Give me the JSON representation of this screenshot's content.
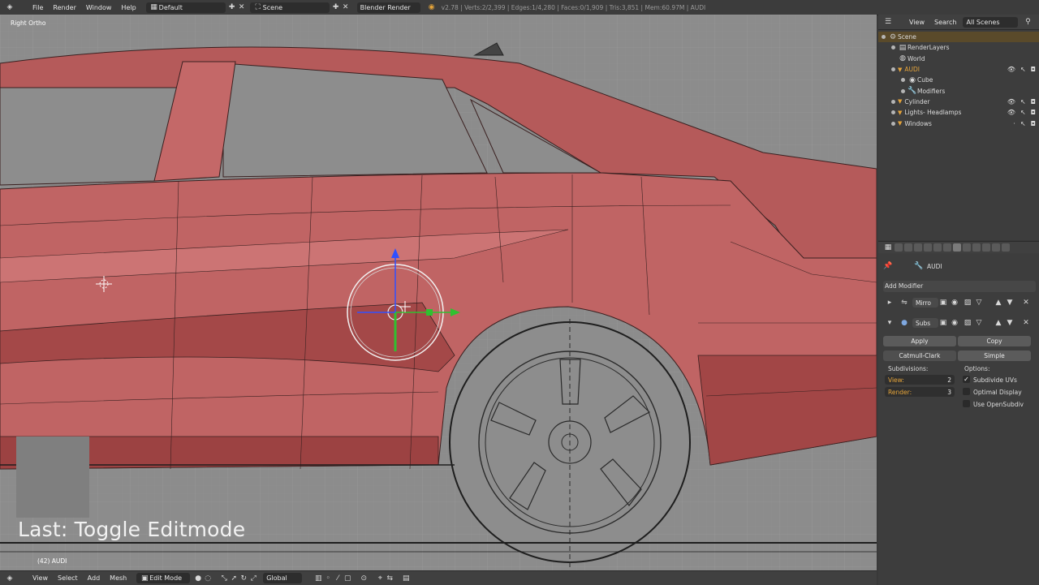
{
  "topbar": {
    "menus": [
      "File",
      "Render",
      "Window",
      "Help"
    ],
    "layout": "Default",
    "scene": "Scene",
    "engine": "Blender Render",
    "stats": "v2.78 | Verts:2/2,399 | Edges:1/4,280 | Faces:0/1,909 | Tris:3,851 | Mem:60.97M | AUDI"
  },
  "viewport": {
    "view_label": "Right Ortho",
    "last_operator": "Last: Toggle Editmode",
    "object_label": "(42) AUDI",
    "background": "#8b8b8b",
    "body_color": "#b95a5a"
  },
  "vp_header": {
    "menus": [
      "View",
      "Select",
      "Add",
      "Mesh"
    ],
    "mode": "Edit Mode",
    "orientation": "Global"
  },
  "outliner": {
    "view_menu": "View",
    "search_menu": "Search",
    "display": "All Scenes",
    "items": [
      {
        "label": "Scene"
      },
      {
        "label": "RenderLayers"
      },
      {
        "label": "World"
      },
      {
        "label": "AUDI"
      },
      {
        "label": "Cube"
      },
      {
        "label": "Modifiers"
      },
      {
        "label": "Cylinder"
      },
      {
        "label": "Lights- Headlamps"
      },
      {
        "label": "Windows"
      }
    ]
  },
  "properties": {
    "object_name": "AUDI",
    "add_modifier": "Add Modifier",
    "modifiers": [
      {
        "name": "Mirro"
      },
      {
        "name": "Subs"
      }
    ],
    "apply": "Apply",
    "copy": "Copy",
    "catmull": "Catmull-Clark",
    "simple": "Simple",
    "subdivisions_label": "Subdivisions:",
    "options_label": "Options:",
    "view_label": "View:",
    "view_value": "2",
    "render_label": "Render:",
    "render_value": "3",
    "subdivide_uvs": "Subdivide UVs",
    "optimal_display": "Optimal Display",
    "use_opensubdiv": "Use OpenSubdiv"
  }
}
